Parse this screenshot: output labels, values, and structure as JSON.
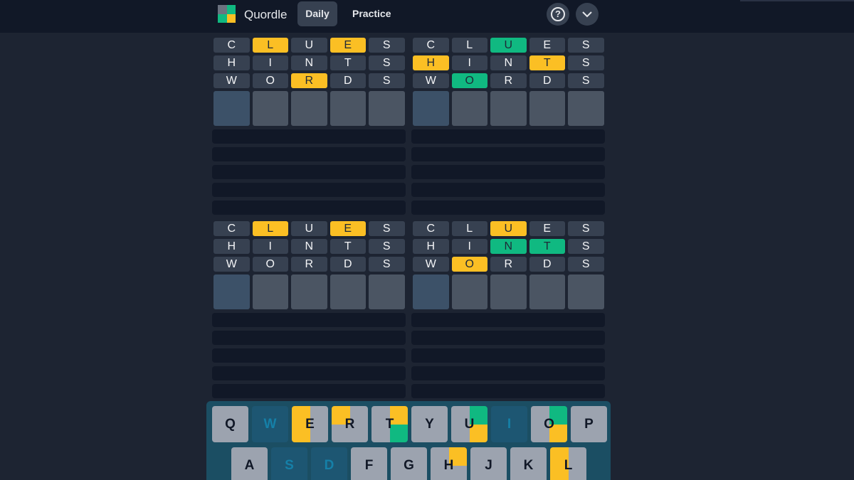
{
  "header": {
    "app_title": "Quordle",
    "tabs": [
      {
        "label": "Daily",
        "active": true
      },
      {
        "label": "Practice",
        "active": false
      }
    ],
    "help_icon": "?",
    "menu_icon": "chevron-down"
  },
  "colors": {
    "yellow": "#fbbf24",
    "green": "#10b981",
    "gray": "#9ca3af",
    "absent": "#1d5672",
    "tile_bg": "#374151"
  },
  "boards": [
    {
      "rows": [
        [
          {
            "l": "C",
            "s": "none"
          },
          {
            "l": "L",
            "s": "yellow"
          },
          {
            "l": "U",
            "s": "none"
          },
          {
            "l": "E",
            "s": "yellow"
          },
          {
            "l": "S",
            "s": "none"
          }
        ],
        [
          {
            "l": "H",
            "s": "none"
          },
          {
            "l": "I",
            "s": "none"
          },
          {
            "l": "N",
            "s": "none"
          },
          {
            "l": "T",
            "s": "none"
          },
          {
            "l": "S",
            "s": "none"
          }
        ],
        [
          {
            "l": "W",
            "s": "none"
          },
          {
            "l": "O",
            "s": "none"
          },
          {
            "l": "R",
            "s": "yellow"
          },
          {
            "l": "D",
            "s": "none"
          },
          {
            "l": "S",
            "s": "none"
          }
        ]
      ]
    },
    {
      "rows": [
        [
          {
            "l": "C",
            "s": "none"
          },
          {
            "l": "L",
            "s": "none"
          },
          {
            "l": "U",
            "s": "green"
          },
          {
            "l": "E",
            "s": "none"
          },
          {
            "l": "S",
            "s": "none"
          }
        ],
        [
          {
            "l": "H",
            "s": "yellow"
          },
          {
            "l": "I",
            "s": "none"
          },
          {
            "l": "N",
            "s": "none"
          },
          {
            "l": "T",
            "s": "yellow"
          },
          {
            "l": "S",
            "s": "none"
          }
        ],
        [
          {
            "l": "W",
            "s": "none"
          },
          {
            "l": "O",
            "s": "green"
          },
          {
            "l": "R",
            "s": "none"
          },
          {
            "l": "D",
            "s": "none"
          },
          {
            "l": "S",
            "s": "none"
          }
        ]
      ]
    },
    {
      "rows": [
        [
          {
            "l": "C",
            "s": "none"
          },
          {
            "l": "L",
            "s": "yellow"
          },
          {
            "l": "U",
            "s": "none"
          },
          {
            "l": "E",
            "s": "yellow"
          },
          {
            "l": "S",
            "s": "none"
          }
        ],
        [
          {
            "l": "H",
            "s": "none"
          },
          {
            "l": "I",
            "s": "none"
          },
          {
            "l": "N",
            "s": "none"
          },
          {
            "l": "T",
            "s": "none"
          },
          {
            "l": "S",
            "s": "none"
          }
        ],
        [
          {
            "l": "W",
            "s": "none"
          },
          {
            "l": "O",
            "s": "none"
          },
          {
            "l": "R",
            "s": "none"
          },
          {
            "l": "D",
            "s": "none"
          },
          {
            "l": "S",
            "s": "none"
          }
        ]
      ]
    },
    {
      "rows": [
        [
          {
            "l": "C",
            "s": "none"
          },
          {
            "l": "L",
            "s": "none"
          },
          {
            "l": "U",
            "s": "yellow"
          },
          {
            "l": "E",
            "s": "none"
          },
          {
            "l": "S",
            "s": "none"
          }
        ],
        [
          {
            "l": "H",
            "s": "none"
          },
          {
            "l": "I",
            "s": "none"
          },
          {
            "l": "N",
            "s": "green"
          },
          {
            "l": "T",
            "s": "green"
          },
          {
            "l": "S",
            "s": "none"
          }
        ],
        [
          {
            "l": "W",
            "s": "none"
          },
          {
            "l": "O",
            "s": "yellow"
          },
          {
            "l": "R",
            "s": "none"
          },
          {
            "l": "D",
            "s": "none"
          },
          {
            "l": "S",
            "s": "none"
          }
        ]
      ]
    }
  ],
  "keyboard": {
    "rows": [
      [
        {
          "l": "Q",
          "q": [
            "gray",
            "gray",
            "gray",
            "gray"
          ]
        },
        {
          "l": "W",
          "q": [
            "dark",
            "dark",
            "dark",
            "dark"
          ]
        },
        {
          "l": "E",
          "q": [
            "yellow",
            "gray",
            "yellow",
            "gray"
          ]
        },
        {
          "l": "R",
          "q": [
            "yellow",
            "gray",
            "gray",
            "gray"
          ]
        },
        {
          "l": "T",
          "q": [
            "gray",
            "yellow",
            "gray",
            "green"
          ]
        },
        {
          "l": "Y",
          "q": [
            "gray",
            "gray",
            "gray",
            "gray"
          ]
        },
        {
          "l": "U",
          "q": [
            "gray",
            "green",
            "gray",
            "yellow"
          ]
        },
        {
          "l": "I",
          "q": [
            "dark",
            "dark",
            "dark",
            "dark"
          ]
        },
        {
          "l": "O",
          "q": [
            "gray",
            "green",
            "gray",
            "yellow"
          ]
        },
        {
          "l": "P",
          "q": [
            "gray",
            "gray",
            "gray",
            "gray"
          ]
        }
      ],
      [
        {
          "l": "A",
          "q": [
            "gray",
            "gray",
            "gray",
            "gray"
          ]
        },
        {
          "l": "S",
          "q": [
            "dark",
            "dark",
            "dark",
            "dark"
          ]
        },
        {
          "l": "D",
          "q": [
            "dark",
            "dark",
            "dark",
            "dark"
          ]
        },
        {
          "l": "F",
          "q": [
            "gray",
            "gray",
            "gray",
            "gray"
          ]
        },
        {
          "l": "G",
          "q": [
            "gray",
            "gray",
            "gray",
            "gray"
          ]
        },
        {
          "l": "H",
          "q": [
            "gray",
            "yellow",
            "gray",
            "gray"
          ]
        },
        {
          "l": "J",
          "q": [
            "gray",
            "gray",
            "gray",
            "gray"
          ]
        },
        {
          "l": "K",
          "q": [
            "gray",
            "gray",
            "gray",
            "gray"
          ]
        },
        {
          "l": "L",
          "q": [
            "yellow",
            "gray",
            "yellow",
            "gray"
          ]
        }
      ]
    ]
  }
}
